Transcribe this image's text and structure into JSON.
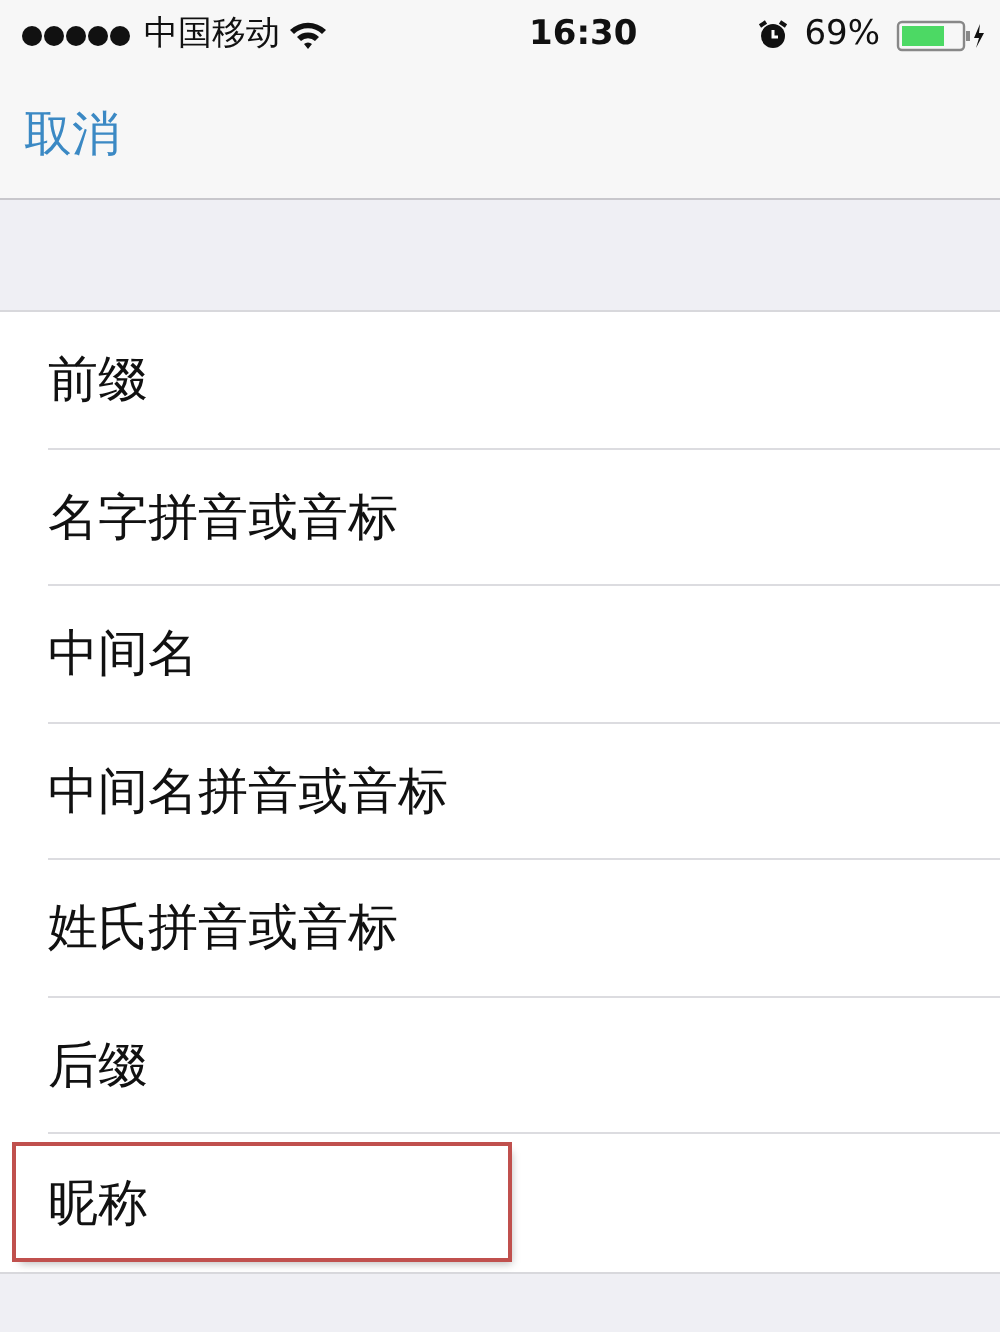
{
  "status_bar": {
    "carrier": "中国移动",
    "time": "16:30",
    "battery": "69%"
  },
  "nav": {
    "cancel": "取消"
  },
  "fields": [
    {
      "label": "前缀",
      "highlighted": false
    },
    {
      "label": "名字拼音或音标",
      "highlighted": false
    },
    {
      "label": "中间名",
      "highlighted": false
    },
    {
      "label": "中间名拼音或音标",
      "highlighted": false
    },
    {
      "label": "姓氏拼音或音标",
      "highlighted": false
    },
    {
      "label": "后缀",
      "highlighted": false
    },
    {
      "label": "昵称",
      "highlighted": true
    }
  ]
}
